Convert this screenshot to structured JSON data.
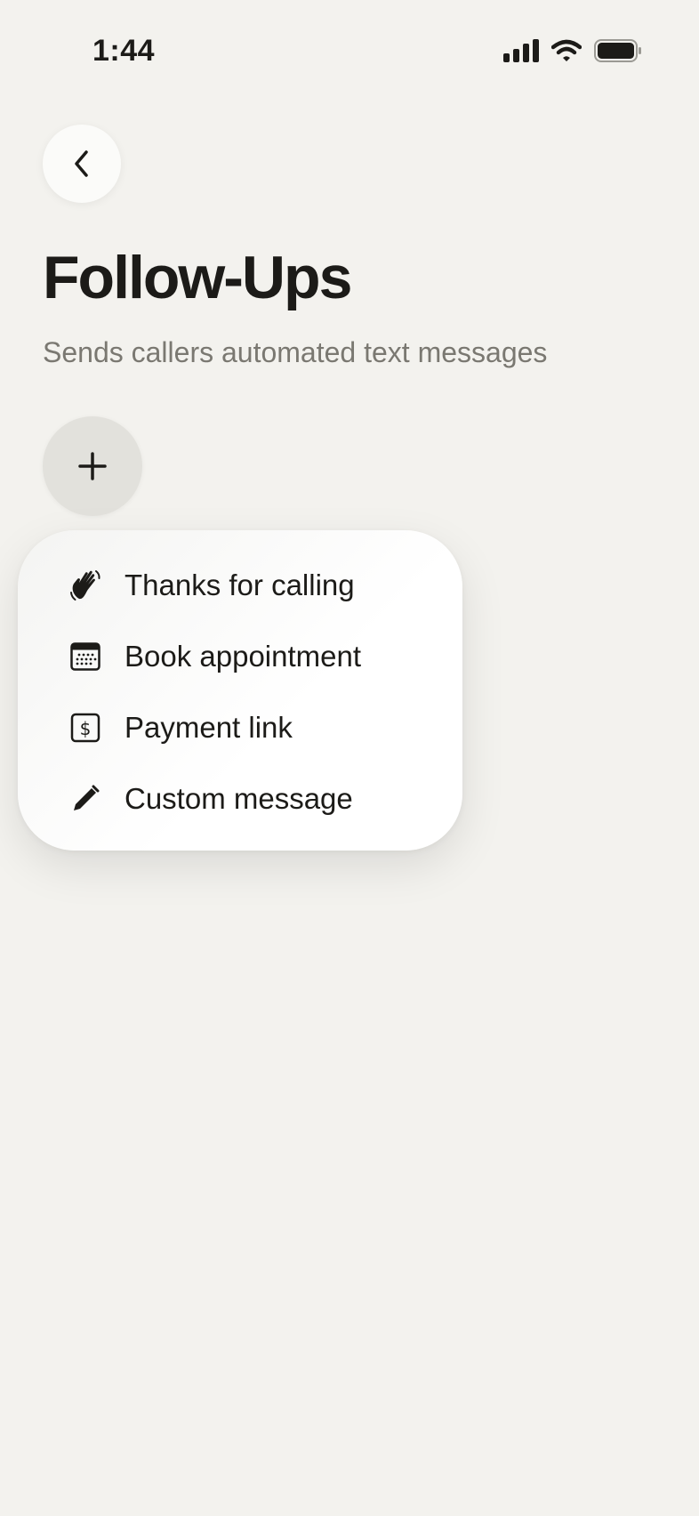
{
  "status_bar": {
    "time": "1:44"
  },
  "header": {
    "title": "Follow-Ups",
    "subtitle": "Sends callers automated text messages"
  },
  "menu": {
    "items": [
      {
        "label": "Thanks for calling",
        "icon": "waving-hand-icon"
      },
      {
        "label": "Book appointment",
        "icon": "calendar-icon"
      },
      {
        "label": "Payment link",
        "icon": "dollar-icon"
      },
      {
        "label": "Custom message",
        "icon": "pencil-icon"
      }
    ]
  },
  "colors": {
    "background": "#f3f2ee",
    "text": "#1c1b18",
    "subtitle": "#7a7871",
    "add_button": "#e2e1dc"
  }
}
